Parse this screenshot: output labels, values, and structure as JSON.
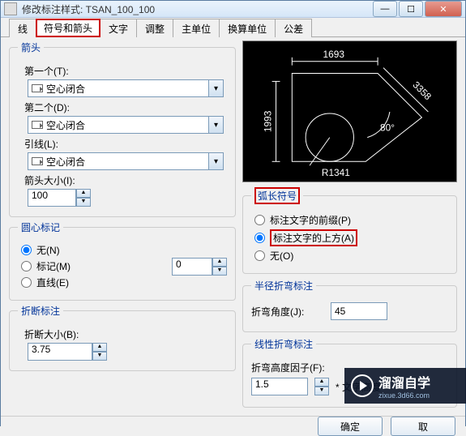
{
  "window": {
    "title": "修改标注样式: TSAN_100_100"
  },
  "tabs": [
    "线",
    "符号和箭头",
    "文字",
    "调整",
    "主单位",
    "换算单位",
    "公差"
  ],
  "active_tab_index": 1,
  "arrows": {
    "legend": "箭头",
    "first_label": "第一个(T):",
    "first_value": "空心闭合",
    "second_label": "第二个(D):",
    "second_value": "空心闭合",
    "leader_label": "引线(L):",
    "leader_value": "空心闭合",
    "size_label": "箭头大小(I):",
    "size_value": "100"
  },
  "center_mark": {
    "legend": "圆心标记",
    "options": [
      {
        "label": "无(N)",
        "value": "none",
        "checked": true
      },
      {
        "label": "标记(M)",
        "value": "mark",
        "checked": false
      },
      {
        "label": "直线(E)",
        "value": "line",
        "checked": false
      }
    ],
    "size_value": "0"
  },
  "break_dim": {
    "legend": "折断标注",
    "size_label": "折断大小(B):",
    "size_value": "3.75"
  },
  "arc_symbol": {
    "legend": "弧长符号",
    "options": [
      {
        "label": "标注文字的前缀(P)",
        "value": "prefix",
        "checked": false
      },
      {
        "label": "标注文字的上方(A)",
        "value": "above",
        "checked": true
      },
      {
        "label": "无(O)",
        "value": "none",
        "checked": false
      }
    ]
  },
  "radius_jog": {
    "legend": "半径折弯标注",
    "angle_label": "折弯角度(J):",
    "angle_value": "45"
  },
  "linear_jog": {
    "legend": "线性折弯标注",
    "factor_label": "折弯高度因子(F):",
    "factor_value": "1.5",
    "suffix": "* 文字高度"
  },
  "preview_labels": {
    "top": "1693",
    "left": "1993",
    "bottom": "R1341",
    "angle": "80°",
    "right": "3358"
  },
  "footer": {
    "ok": "确定",
    "cancel": "取"
  },
  "watermark": {
    "main": "溜溜自学",
    "sub": "zixue.3d66.com"
  }
}
